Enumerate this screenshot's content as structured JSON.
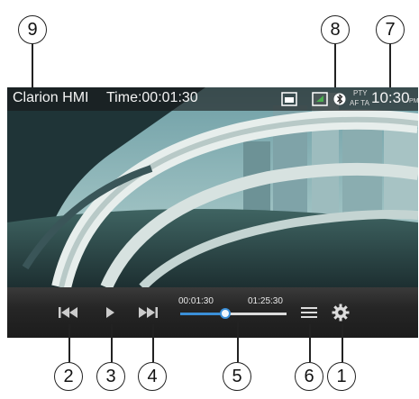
{
  "callouts": {
    "c9": "9",
    "c8": "8",
    "c7": "7",
    "c2": "2",
    "c3": "3",
    "c4": "4",
    "c5": "5",
    "c6": "6",
    "c1": "1"
  },
  "status": {
    "app_title": "Clarion HMI",
    "time_label": "Time:00:01:30",
    "pty": "PTY",
    "af_ta": "AF TA",
    "clock": "10:30",
    "ampm": "PM"
  },
  "player": {
    "elapsed": "00:01:30",
    "total": "01:25:30",
    "progress": 0.42
  },
  "colors": {
    "accent": "#3b8fd8",
    "bt_badge": "#ffffff",
    "media_icon": "#4caf50"
  },
  "icons": {
    "prev": "prev-track-icon",
    "play": "play-icon",
    "next": "next-track-icon",
    "list": "list-icon",
    "settings": "gear-icon",
    "video_source": "video-source-icon",
    "media": "media-icon",
    "bluetooth": "bluetooth-icon"
  }
}
